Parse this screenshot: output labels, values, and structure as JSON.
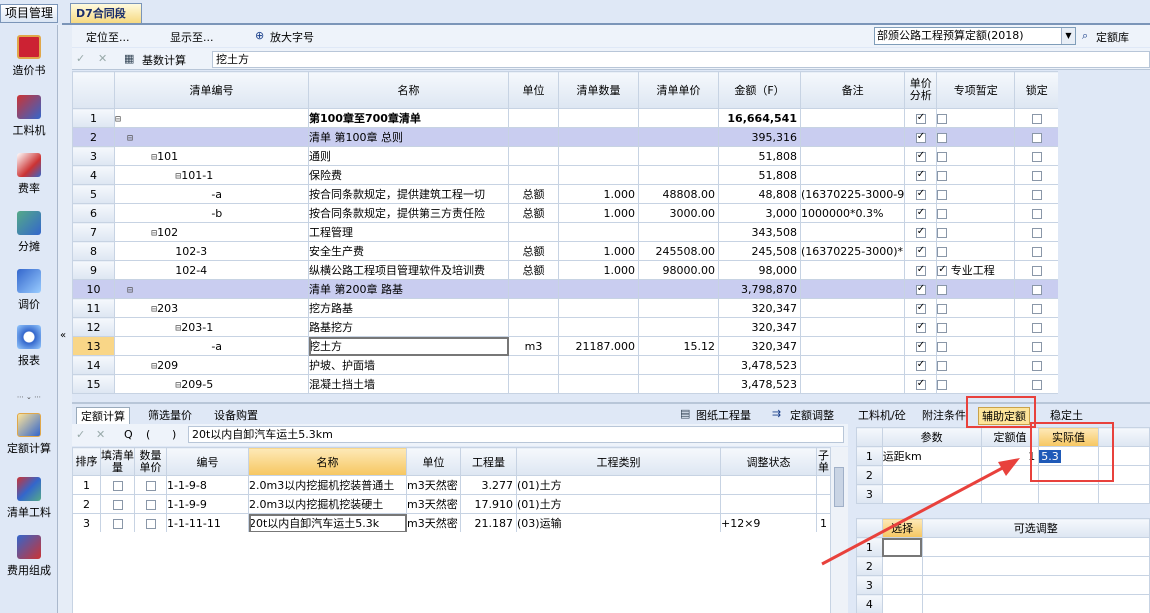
{
  "header": {
    "project_tab": "项目管理",
    "doc_tab": "D7合同段"
  },
  "leftbar": {
    "items": [
      {
        "label": "造价书"
      },
      {
        "label": "工料机"
      },
      {
        "label": "费率"
      },
      {
        "label": "分摊"
      },
      {
        "label": "调价"
      },
      {
        "label": "报表"
      }
    ],
    "bottom_items": [
      {
        "label": "定额计算"
      },
      {
        "label": "清单工料"
      },
      {
        "label": "费用组成"
      }
    ]
  },
  "toolbar": {
    "locate": "定位至...",
    "show": "显示至...",
    "zoom": "放大字号",
    "quota_select": "部颁公路工程预算定额(2018)",
    "quota_lib": "定额库",
    "base_calc": "基数计算",
    "formula": "挖土方"
  },
  "main_table": {
    "headers": [
      "清单编号",
      "名称",
      "单位",
      "清单数量",
      "清单单价",
      "金额（F）",
      "备注",
      "单价分析",
      "专项暂定",
      "锁定"
    ],
    "rows": [
      {
        "n": "1",
        "tree": "⊟",
        "code": "",
        "name": "第100章至700章清单",
        "unit": "",
        "qty": "",
        "price": "",
        "amount": "16,664,541",
        "note": "",
        "a": true,
        "b": false,
        "c": false,
        "bold": true
      },
      {
        "n": "2",
        "tree": "  ⊟",
        "code": "",
        "name": "清单 第100章  总则",
        "unit": "",
        "qty": "",
        "price": "",
        "amount": "395,316",
        "note": "",
        "a": true,
        "b": false,
        "c": false,
        "band": true
      },
      {
        "n": "3",
        "tree": "      ⊟",
        "code": "101",
        "name": "通则",
        "unit": "",
        "qty": "",
        "price": "",
        "amount": "51,808",
        "note": "",
        "a": true,
        "b": false,
        "c": false
      },
      {
        "n": "4",
        "tree": "          ⊟",
        "code": "101-1",
        "name": "保险费",
        "unit": "",
        "qty": "",
        "price": "",
        "amount": "51,808",
        "note": "",
        "a": true,
        "b": false,
        "c": false
      },
      {
        "n": "5",
        "tree": "                ",
        "code": "-a",
        "name": "按合同条款规定，提供建筑工程一切",
        "unit": "总额",
        "qty": "1.000",
        "price": "48808.00",
        "amount": "48,808",
        "note": "(16370225-3000-9",
        "a": true,
        "b": false,
        "c": false
      },
      {
        "n": "6",
        "tree": "                ",
        "code": "-b",
        "name": "按合同条款规定，提供第三方责任险",
        "unit": "总额",
        "qty": "1.000",
        "price": "3000.00",
        "amount": "3,000",
        "note": "1000000*0.3%",
        "a": true,
        "b": false,
        "c": false
      },
      {
        "n": "7",
        "tree": "      ⊟",
        "code": "102",
        "name": "工程管理",
        "unit": "",
        "qty": "",
        "price": "",
        "amount": "343,508",
        "note": "",
        "a": true,
        "b": false,
        "c": false
      },
      {
        "n": "8",
        "tree": "          ",
        "code": "102-3",
        "name": "安全生产费",
        "unit": "总额",
        "qty": "1.000",
        "price": "245508.00",
        "amount": "245,508",
        "note": "(16370225-3000)*",
        "a": true,
        "b": false,
        "c": false
      },
      {
        "n": "9",
        "tree": "          ",
        "code": "102-4",
        "name": "纵横公路工程项目管理软件及培训费",
        "unit": "总额",
        "qty": "1.000",
        "price": "98000.00",
        "amount": "98,000",
        "note": "",
        "a": true,
        "b": true,
        "c": false,
        "special": "专业工程"
      },
      {
        "n": "10",
        "tree": "  ⊟",
        "code": "",
        "name": "清单 第200章  路基",
        "unit": "",
        "qty": "",
        "price": "",
        "amount": "3,798,870",
        "note": "",
        "a": true,
        "b": false,
        "c": false,
        "band": true
      },
      {
        "n": "11",
        "tree": "      ⊟",
        "code": "203",
        "name": "挖方路基",
        "unit": "",
        "qty": "",
        "price": "",
        "amount": "320,347",
        "note": "",
        "a": true,
        "b": false,
        "c": false
      },
      {
        "n": "12",
        "tree": "          ⊟",
        "code": "203-1",
        "name": "路基挖方",
        "unit": "",
        "qty": "",
        "price": "",
        "amount": "320,347",
        "note": "",
        "a": true,
        "b": false,
        "c": false
      },
      {
        "n": "13",
        "tree": "                ",
        "code": "-a",
        "name": "挖土方",
        "unit": "m3",
        "qty": "21187.000",
        "price": "15.12",
        "amount": "320,347",
        "note": "",
        "a": true,
        "b": false,
        "c": false,
        "sel": true
      },
      {
        "n": "14",
        "tree": "      ⊟",
        "code": "209",
        "name": "护坡、护面墙",
        "unit": "",
        "qty": "",
        "price": "",
        "amount": "3,478,523",
        "note": "",
        "a": true,
        "b": false,
        "c": false
      },
      {
        "n": "15",
        "tree": "          ⊟",
        "code": "209-5",
        "name": "混凝土挡土墙",
        "unit": "",
        "qty": "",
        "price": "",
        "amount": "3,478,523",
        "note": "",
        "a": true,
        "b": false,
        "c": false
      }
    ]
  },
  "bottom": {
    "tabs": [
      "定额计算",
      "筛选量价",
      "设备购置"
    ],
    "right_tools": [
      "图纸工程量",
      "定额调整"
    ],
    "right_tabs": [
      "工料机/砼",
      "附注条件",
      "辅助定额",
      "稳定土"
    ],
    "formula": "20t以内自卸汽车运土5.3km",
    "tb_syms": [
      "✓",
      "✕",
      "Q",
      "(",
      ")"
    ],
    "headers": [
      "排序",
      "填清单量",
      "数量单价",
      "编号",
      "名称",
      "单位",
      "工程量",
      "工程类别",
      "调整状态",
      "子单"
    ],
    "rows": [
      {
        "n": "1",
        "code": "1-1-9-8",
        "name": "2.0m3以内挖掘机挖装普通土",
        "unit": "m3天然密",
        "qty": "3.277",
        "cat": "(01)土方",
        "adj": "",
        "sub": ""
      },
      {
        "n": "2",
        "code": "1-1-9-9",
        "name": "2.0m3以内挖掘机挖装硬土",
        "unit": "m3天然密",
        "qty": "17.910",
        "cat": "(01)土方",
        "adj": "",
        "sub": ""
      },
      {
        "n": "3",
        "code": "1-1-11-11",
        "name": "20t以内自卸汽车运土5.3k",
        "unit": "m3天然密",
        "qty": "21.187",
        "cat": "(03)运输",
        "adj": "+12×9",
        "sub": "1"
      }
    ],
    "params": {
      "headers": [
        "参数",
        "定额值",
        "实际值"
      ],
      "rows": [
        {
          "n": "1",
          "p": "运距km",
          "q": "1",
          "r": "5.3"
        },
        {
          "n": "2",
          "p": "",
          "q": "",
          "r": ""
        },
        {
          "n": "3",
          "p": "",
          "q": "",
          "r": ""
        }
      ]
    },
    "options": {
      "headers": [
        "选择",
        "可选调整"
      ],
      "rows": [
        "1",
        "2",
        "3",
        "4"
      ]
    }
  }
}
